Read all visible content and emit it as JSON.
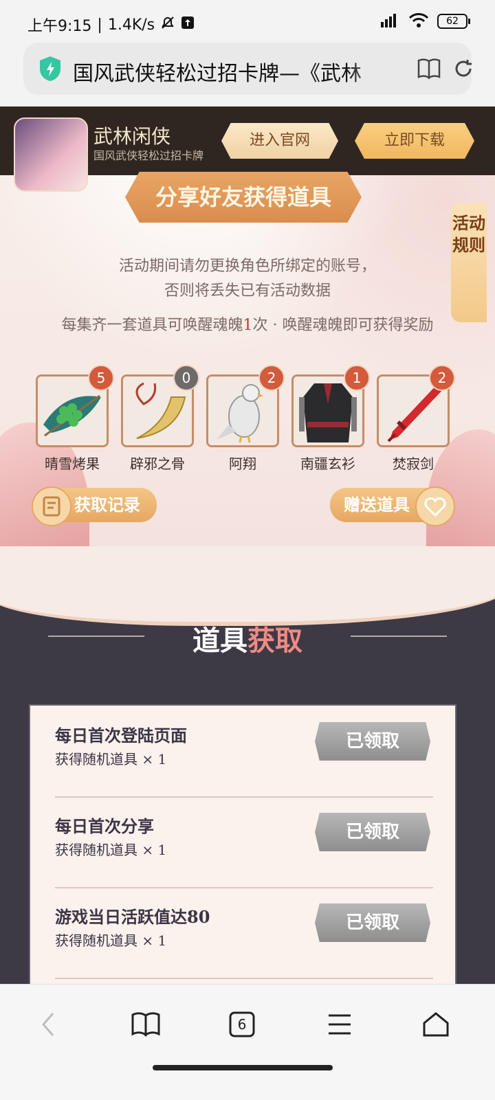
{
  "status_bar": {
    "time": "上午9:15",
    "speed": "1.4K/s",
    "battery": "62"
  },
  "browser": {
    "url_title": "国风武侠轻松过招卡牌—《武林",
    "tab_count": "6"
  },
  "app_banner": {
    "app_name": "武林闲侠",
    "app_subtitle": "国风武侠轻松过招卡牌",
    "official_site_label": "进入官网",
    "download_label": "立即下载"
  },
  "hero": {
    "share_title": "分享好友获得道具",
    "rules_tab": "活动规则",
    "notice_line1": "活动期间请勿更换角色所绑定的账号，",
    "notice_line2": "否则将丢失已有活动数据",
    "collect_prefix": "每集齐一套道具可唤醒魂魄",
    "collect_count": "1",
    "collect_suffix": "次 · 唤醒魂魄即可获得奖励",
    "items": [
      {
        "label": "晴雪烤果",
        "count": "5"
      },
      {
        "label": "辟邪之骨",
        "count": "0"
      },
      {
        "label": "阿翔",
        "count": "2"
      },
      {
        "label": "南疆玄衫",
        "count": "1"
      },
      {
        "label": "焚寂剑",
        "count": "2"
      }
    ],
    "record_button": "获取记录",
    "gift_button": "赠送道具"
  },
  "section": {
    "title_main": "道具",
    "title_accent": "获取"
  },
  "tasks": [
    {
      "name": "每日首次登陆页面",
      "reward": "获得随机道具 × 1",
      "status": "已领取"
    },
    {
      "name": "每日首次分享",
      "reward": "获得随机道具 × 1",
      "status": "已领取"
    },
    {
      "name": "游戏当日活跃值达80",
      "reward": "获得随机道具 × 1",
      "status": "已领取"
    }
  ],
  "colors": {
    "accent": "#e6a762",
    "dark_bg": "#3d3a45",
    "claimed_gray": "#9a9a9a"
  },
  "icons": [
    "shield-icon",
    "book-icon",
    "refresh-icon",
    "back-icon",
    "bookmarks-icon",
    "tabs-icon",
    "menu-icon",
    "home-icon"
  ]
}
